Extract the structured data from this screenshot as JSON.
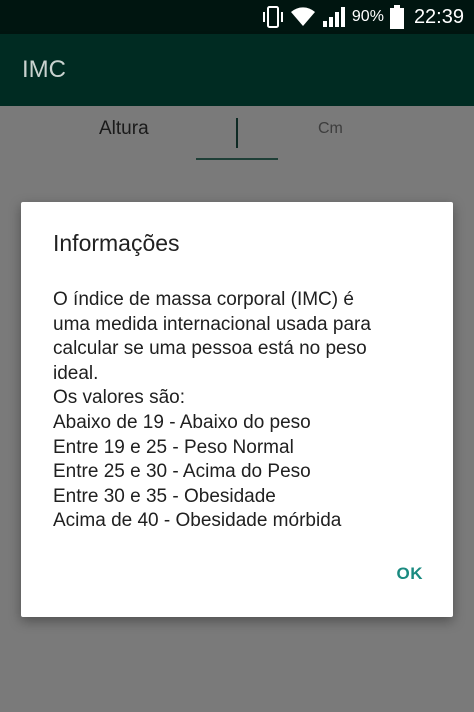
{
  "status_bar": {
    "battery": "90%",
    "time": "22:39",
    "icons": [
      "vibrate-icon",
      "wifi-icon",
      "signal-icon",
      "battery-icon"
    ]
  },
  "app_bar": {
    "title": "IMC"
  },
  "form": {
    "altura_label": "Altura",
    "altura_value": "",
    "unit": "Cm"
  },
  "dialog": {
    "title": "Informações",
    "body_lines": [
      "O índice de massa corporal (IMC) é",
      "uma medida internacional usada para",
      "calcular se uma pessoa está no peso",
      "ideal.",
      "Os valores são:",
      "Abaixo de 19 - Abaixo do peso",
      "Entre 19 e 25 - Peso Normal",
      "Entre 25 e 30 - Acima do Peso",
      "Entre 30 e 35 - Obesidade",
      "Acima de 40 - Obesidade mórbida"
    ],
    "ok_label": "OK"
  },
  "colors": {
    "status_bar": "#001510",
    "app_bar": "#002b22",
    "accent": "#1a8a80",
    "scrim": "#7a7a7a"
  }
}
